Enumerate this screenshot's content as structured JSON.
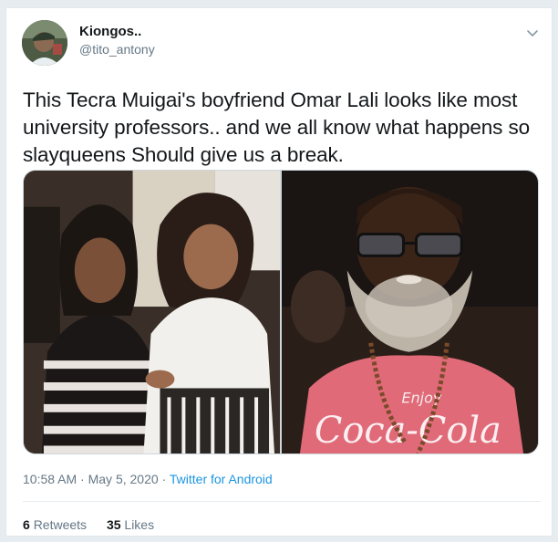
{
  "user": {
    "display_name": "Kiongos..",
    "handle": "@tito_antony",
    "avatar": "avatar-photo"
  },
  "tweet": {
    "text": "This Tecra Muigai's boyfriend Omar Lali looks like most university professors.. and we all know what happens so slayqueens Should give us a break.",
    "time": "10:58 AM",
    "date": "May 5, 2020",
    "separator": "·",
    "source": "Twitter for Android"
  },
  "media": {
    "photos": [
      {
        "icon": "photo-two-women"
      },
      {
        "icon": "photo-bearded-man"
      }
    ],
    "shirt_text_1": "Enjoy",
    "shirt_text_2": "Coca-Cola"
  },
  "stats": {
    "retweets_count": "6",
    "retweets_label": "Retweets",
    "likes_count": "35",
    "likes_label": "Likes"
  },
  "colors": {
    "link": "#1b95e0",
    "secondary_text": "#657786",
    "primary_text": "#14171a",
    "border": "#e1e8ed"
  },
  "icons": {
    "caret": "chevron-down-icon"
  }
}
